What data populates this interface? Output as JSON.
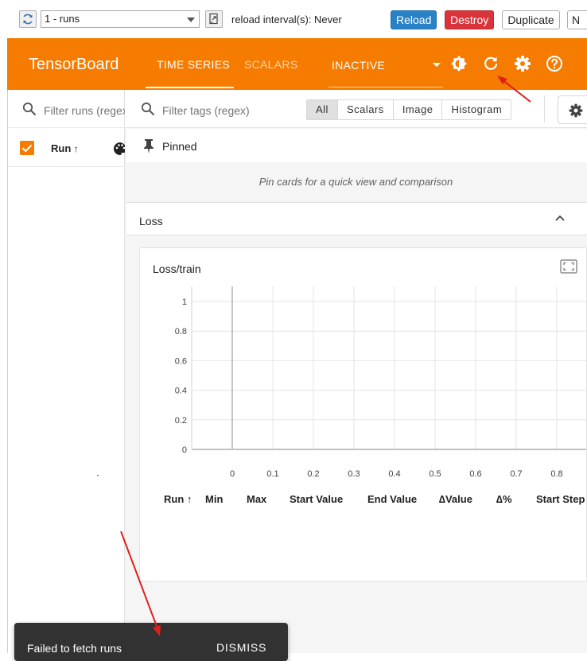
{
  "toolbar": {
    "run_select_value": "1 - runs",
    "reload_interval_label": "reload interval(s): Never",
    "reload_label": "Reload",
    "destroy_label": "Destroy",
    "duplicate_label": "Duplicate",
    "next_label": "N"
  },
  "header": {
    "brand": "TensorBoard",
    "tabs": [
      {
        "label": "TIME SERIES",
        "active": true
      },
      {
        "label": "SCALARS",
        "active": false
      }
    ],
    "inactive_dropdown": "INACTIVE",
    "icons": [
      "theme-icon",
      "refresh-icon",
      "settings-icon",
      "help-icon"
    ]
  },
  "runs_panel": {
    "filter_placeholder": "Filter runs (regex)",
    "column_label": "Run",
    "sort_indicator": "↑"
  },
  "tags_bar": {
    "filter_placeholder": "Filter tags (regex)",
    "type_filters": [
      {
        "label": "All",
        "active": true
      },
      {
        "label": "Scalars",
        "active": false
      },
      {
        "label": "Image",
        "active": false
      },
      {
        "label": "Histogram",
        "active": false
      }
    ]
  },
  "pinned": {
    "label": "Pinned",
    "hint": "Pin cards for a quick view and comparison"
  },
  "group": {
    "label": "Loss"
  },
  "card": {
    "title": "Loss/train",
    "table_headers": [
      "Run ↑",
      "Min",
      "Max",
      "Start Value",
      "End Value",
      "∆Value",
      "∆%",
      "Start Step"
    ]
  },
  "chart_data": {
    "type": "line",
    "title": "Loss/train",
    "series": [],
    "xlim": [
      -0.1,
      0.8
    ],
    "ylim": [
      0,
      1
    ],
    "x_ticks": [
      "0",
      "0.1",
      "0.2",
      "0.3",
      "0.4",
      "0.5",
      "0.6",
      "0.7",
      "0.8"
    ],
    "y_ticks": [
      "0",
      "0.2",
      "0.4",
      "0.6",
      "0.8",
      "1"
    ],
    "grid": true
  },
  "snackbar": {
    "message": "Failed to fetch runs",
    "action": "DISMISS"
  },
  "colors": {
    "header": "#f57c00",
    "reload": "#2a82c6",
    "destroy": "#d9343c",
    "snackbar": "#323232",
    "annotation_arrow": "#e0201b"
  }
}
